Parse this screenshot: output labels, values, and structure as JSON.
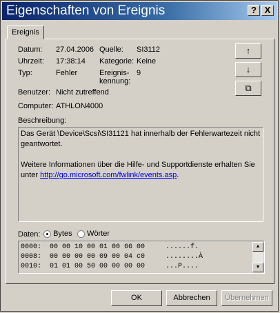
{
  "window": {
    "title": "Eigenschaften von Ereignis",
    "help_glyph": "?",
    "close_glyph": "X"
  },
  "tabs": [
    {
      "label": "Ereignis"
    }
  ],
  "fields": {
    "datum_label": "Datum:",
    "datum_value": "27.04.2006",
    "quelle_label": "Quelle:",
    "quelle_value": "SI3112",
    "uhrzeit_label": "Uhrzeit:",
    "uhrzeit_value": "17:38:14",
    "kategorie_label": "Kategorie:",
    "kategorie_value": "Keine",
    "typ_label": "Typ:",
    "typ_value": "Fehler",
    "kennung_label_1": "Ereignis-",
    "kennung_label_2": "kennung:",
    "kennung_value": "9",
    "benutzer_label": "Benutzer:",
    "benutzer_value": "Nicht zutreffend",
    "computer_label": "Computer:",
    "computer_value": "ATHLON4000"
  },
  "side_buttons": {
    "up": "↑",
    "down": "↓",
    "copy": "⧉"
  },
  "description": {
    "label": "Beschreibung:",
    "line1": "Das Gerät \\Device\\Scsi\\SI31121 hat innerhalb der Fehlerwartezeit nicht geantwortet.",
    "line2_prefix": "Weitere Informationen über die Hilfe- und Supportdienste erhalten Sie unter ",
    "link": "http://go.microsoft.com/fwlink/events.asp",
    "line2_suffix": "."
  },
  "data_section": {
    "label": "Daten:",
    "option_bytes": "Bytes",
    "option_words": "Wörter",
    "selected": "Bytes",
    "rows": [
      "0000:  00 00 10 00 01 00 66 00     ......f.",
      "0008:  00 00 00 00 09 00 04 c0     ........À",
      "0010:  01 01 00 50 00 00 00 00     ...P...."
    ]
  },
  "footer": {
    "ok": "OK",
    "cancel": "Abbrechen",
    "apply": "Übernehmen"
  }
}
